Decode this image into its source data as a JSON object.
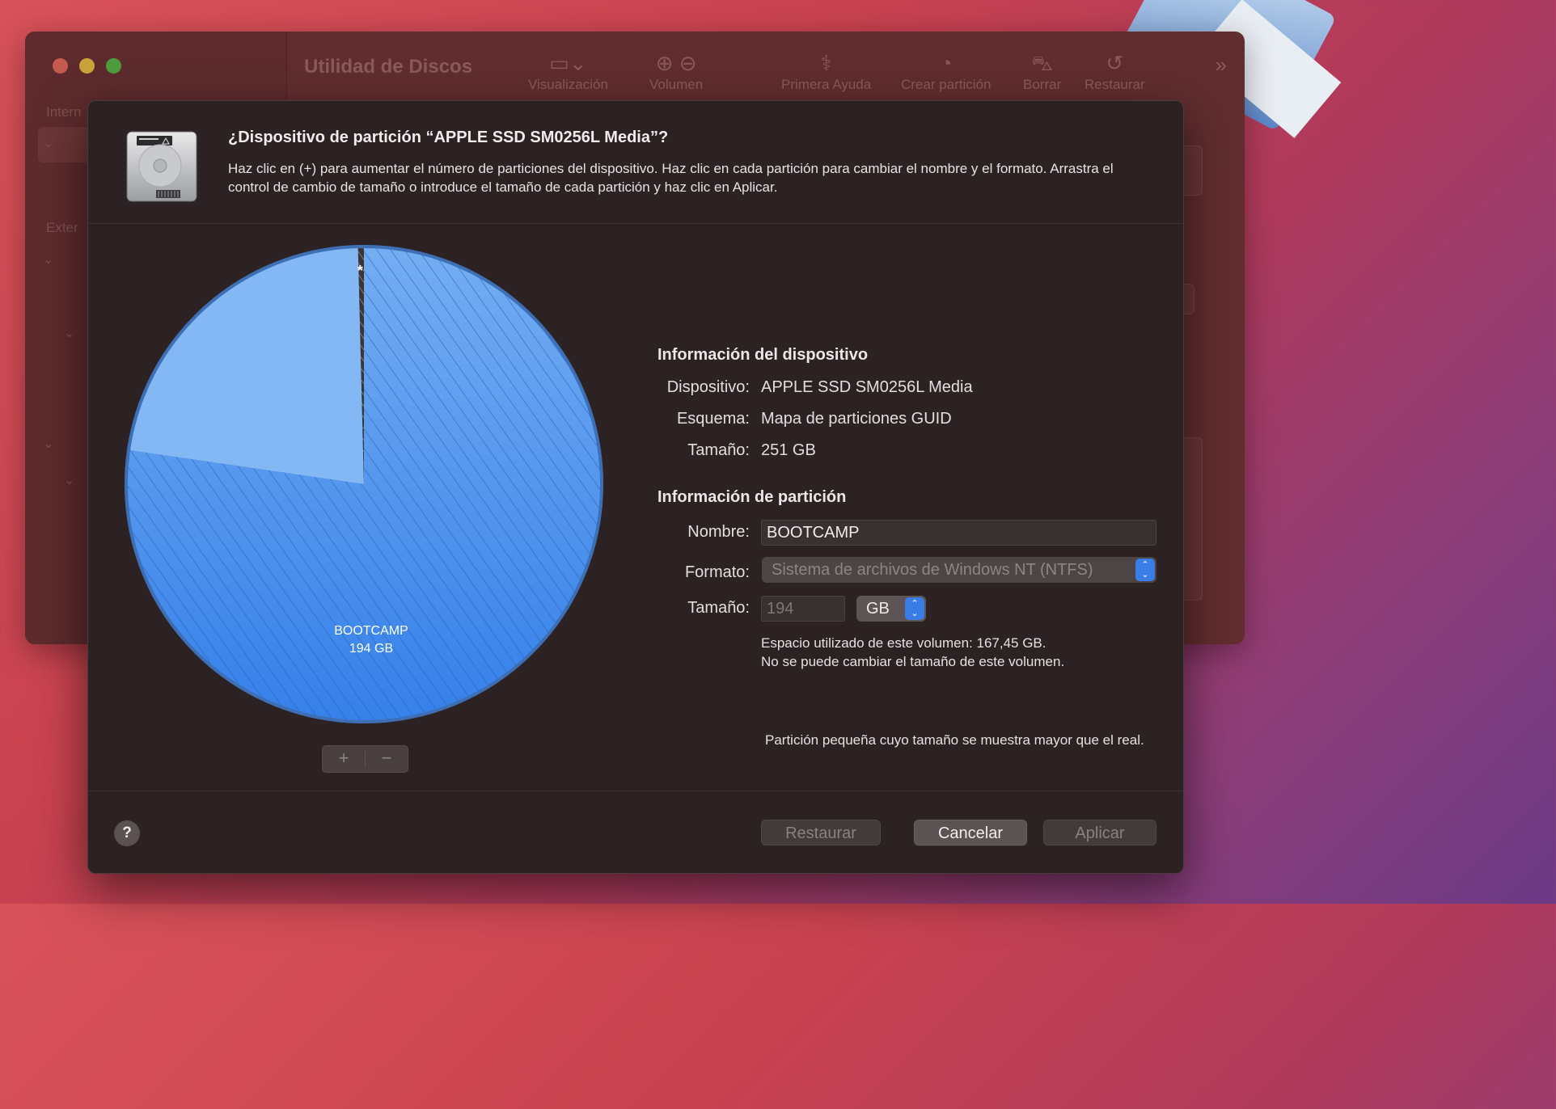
{
  "background_window": {
    "title": "Utilidad de Discos",
    "sidebar_headings": [
      "Intern",
      "Exter"
    ],
    "toolbar": [
      {
        "label": "Visualización",
        "icon": "sidebar-icon"
      },
      {
        "label": "Volumen",
        "icon": "plus-minus-icon"
      },
      {
        "label": "Primera Ayuda",
        "icon": "stethoscope-icon"
      },
      {
        "label": "Crear partición",
        "icon": "pie-icon"
      },
      {
        "label": "Borrar",
        "icon": "car-icon"
      },
      {
        "label": "Restaurar",
        "icon": "restore-icon"
      }
    ]
  },
  "dialog": {
    "title": "¿Dispositivo de partición “APPLE SSD SM0256L Media”?",
    "description": "Haz clic en (+) para aumentar el número de particiones del dispositivo. Haz clic en cada partición para cambiar el nombre y el formato. Arrastra el control de cambio de tamaño o introduce el tamaño de cada partición y haz clic en Aplicar.",
    "pie": {
      "partitions": [
        {
          "name": "BOOTCAMP",
          "size": "194 GB",
          "label": "BOOTCAMP",
          "size_label": "194 GB",
          "color": "#3b82e8",
          "selected": true
        },
        {
          "name": "small",
          "size_gb": 1,
          "marker": "*",
          "color": "#3a3436"
        },
        {
          "name": "free",
          "size_gb": 56,
          "color": "#7fb3f5"
        }
      ],
      "add_label": "+",
      "remove_label": "−"
    },
    "device_info": {
      "heading": "Información del dispositivo",
      "device_label": "Dispositivo:",
      "device_value": "APPLE SSD SM0256L Media",
      "scheme_label": "Esquema:",
      "scheme_value": "Mapa de particiones GUID",
      "size_label": "Tamaño:",
      "size_value": "251 GB"
    },
    "partition_info": {
      "heading": "Información de partición",
      "name_label": "Nombre:",
      "name_value": "BOOTCAMP",
      "format_label": "Formato:",
      "format_value": "Sistema de archivos de Windows NT (NTFS)",
      "size_label": "Tamaño:",
      "size_value": "194",
      "unit_value": "GB",
      "used_note": "Espacio utilizado de este volumen: 167,45 GB.",
      "resize_note": "No se puede cambiar el tamaño de este volumen.",
      "small_note": "Partición pequeña cuyo tamaño se muestra mayor que el real."
    },
    "buttons": {
      "help": "?",
      "restore": "Restaurar",
      "cancel": "Cancelar",
      "apply": "Aplicar"
    }
  }
}
